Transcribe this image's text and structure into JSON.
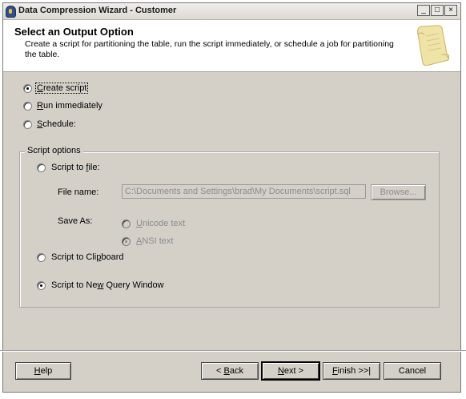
{
  "window": {
    "title": "Data Compression Wizard - Customer",
    "controls": {
      "minimize": "_",
      "maximize": "□",
      "close": "×"
    }
  },
  "header": {
    "title": "Select an Output Option",
    "description": "Create a script for partitioning the table, run the script immediately, or schedule a job for partitioning the table.",
    "icon": "scroll-icon"
  },
  "output_options": {
    "create_script": {
      "pre": "",
      "key": "C",
      "post": "reate script",
      "selected": true
    },
    "run_immediately": {
      "pre": "",
      "key": "R",
      "post": "un immediately",
      "selected": false
    },
    "schedule": {
      "pre": "",
      "key": "S",
      "post": "chedule:",
      "selected": false
    }
  },
  "script_options": {
    "legend": "Script options",
    "to_file": {
      "pre": "Script to ",
      "key": "f",
      "post": "ile:",
      "selected": false
    },
    "file_name_label": "File name:",
    "file_name_value": "C:\\Documents and Settings\\brad\\My Documents\\script.sql",
    "browse_label": "Browse...",
    "save_as_label": "Save As:",
    "unicode": {
      "pre": "",
      "key": "U",
      "post": "nicode text",
      "selected": false
    },
    "ansi": {
      "pre": "",
      "key": "A",
      "post": "NSI text",
      "selected": true
    },
    "to_clipboard": {
      "pre": "Script to Cli",
      "key": "p",
      "post": "board",
      "selected": false
    },
    "to_new_query": {
      "pre": "Script to Ne",
      "key": "w",
      "post": " Query Window",
      "selected": true
    }
  },
  "buttons": {
    "help": {
      "pre": "",
      "key": "H",
      "post": "elp"
    },
    "back": {
      "pre": "< ",
      "key": "B",
      "post": "ack"
    },
    "next": {
      "pre": "",
      "key": "N",
      "post": "ext >"
    },
    "finish": {
      "pre": "",
      "key": "F",
      "post": "inish >>|"
    },
    "cancel": {
      "pre": "",
      "key": "",
      "post": "Cancel"
    }
  }
}
